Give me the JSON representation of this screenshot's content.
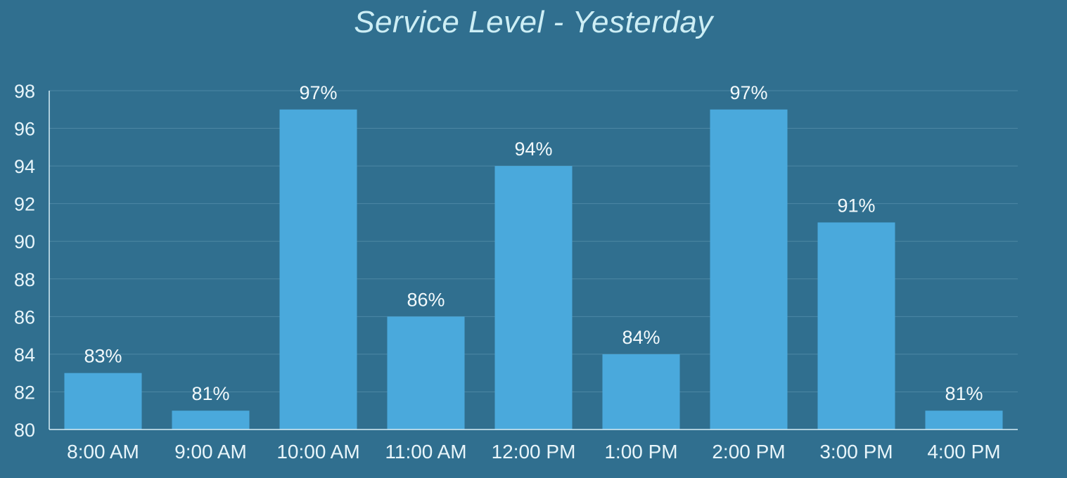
{
  "chart_data": {
    "type": "bar",
    "title": "Service Level - Yesterday",
    "xlabel": "",
    "ylabel": "",
    "categories": [
      "8:00 AM",
      "9:00 AM",
      "10:00 AM",
      "11:00 AM",
      "12:00 PM",
      "1:00 PM",
      "2:00 PM",
      "3:00 PM",
      "4:00 PM"
    ],
    "values": [
      83,
      81,
      97,
      86,
      94,
      84,
      97,
      91,
      81
    ],
    "data_labels": [
      "83%",
      "81%",
      "97%",
      "86%",
      "94%",
      "84%",
      "97%",
      "91%",
      "81%"
    ],
    "ylim": [
      80,
      98
    ],
    "yticks": [
      "80",
      "82",
      "84",
      "86",
      "88",
      "90",
      "92",
      "94",
      "96",
      "98"
    ],
    "grid": true,
    "legend": "none",
    "colors": {
      "background": "#306f8f",
      "bar": "#4aa9dc",
      "gridline": "#4c87a4",
      "axis": "#d8eef6",
      "title": "#cdeef5",
      "text": "#e8f5fa"
    }
  }
}
